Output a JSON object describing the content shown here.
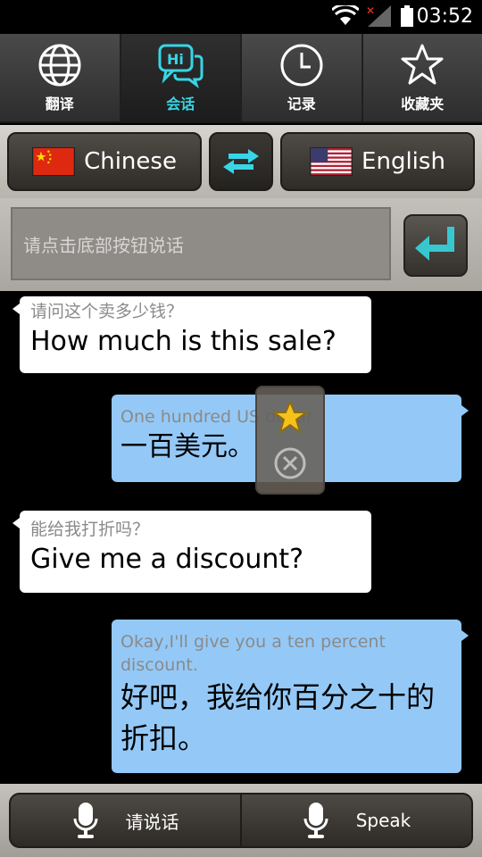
{
  "status": {
    "time": "03:52"
  },
  "tabs": [
    {
      "label": "翻译",
      "icon": "globe-icon"
    },
    {
      "label": "会话",
      "icon": "chat-icon",
      "icon_text": "Hi",
      "active": true
    },
    {
      "label": "记录",
      "icon": "clock-icon"
    },
    {
      "label": "收藏夹",
      "icon": "star-icon"
    }
  ],
  "languages": {
    "source": "Chinese",
    "target": "English"
  },
  "input": {
    "placeholder": "请点击底部按钮说话"
  },
  "conversation": [
    {
      "side": "left",
      "sub": "请问这个卖多少钱？",
      "main": "How much is this sale?"
    },
    {
      "side": "right",
      "sub": "One hundred US dollar.",
      "main": "一百美元。"
    },
    {
      "side": "left",
      "sub": "能给我打折吗？",
      "main": "Give me a discount?"
    },
    {
      "side": "right",
      "sub": "Okay,I'll give you a ten percent discount.",
      "main": "好吧，我给你百分之十的折扣。"
    }
  ],
  "bottom": {
    "left_label": "请说话",
    "right_label": "Speak"
  },
  "colors": {
    "accent": "#38d5e6",
    "bubble_right": "#94c9f7",
    "bubble_left": "#ffffff"
  }
}
